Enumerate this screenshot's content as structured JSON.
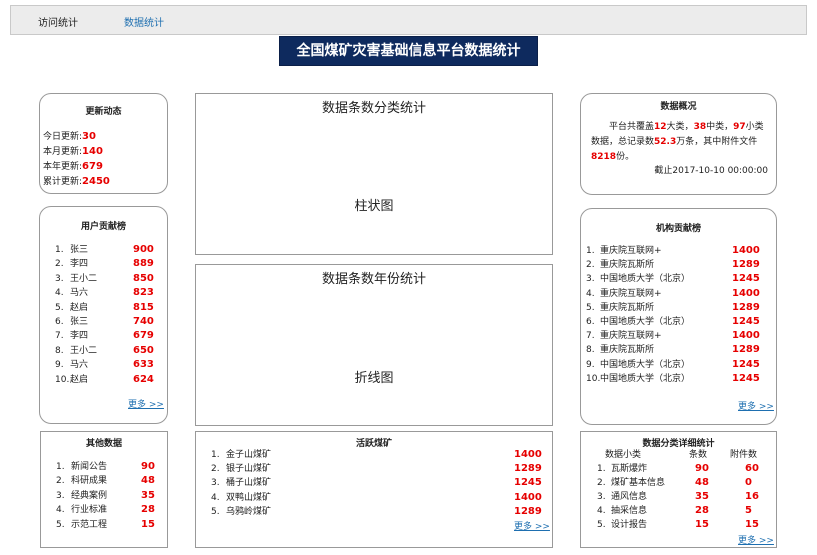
{
  "tabs": [
    {
      "label": "访问统计"
    },
    {
      "label": "数据统计"
    }
  ],
  "title": "全国煤矿灾害基础信息平台数据统计",
  "updates": {
    "title": "更新动态",
    "rows": [
      {
        "label": "今日更新:",
        "value": "30"
      },
      {
        "label": "本月更新:",
        "value": "140"
      },
      {
        "label": "本年更新:",
        "value": "679"
      },
      {
        "label": "累计更新:",
        "value": "2450"
      }
    ]
  },
  "category_chart": {
    "title": "数据条数分类统计",
    "placeholder": "柱状图"
  },
  "year_chart": {
    "title": "数据条数年份统计",
    "placeholder": "折线图"
  },
  "overview": {
    "title": "数据概况",
    "text_parts": [
      "平台共覆盖",
      "12",
      "大类，",
      "38",
      "中类，",
      "97",
      "小类数据，总记录数",
      "52.3",
      "万条，其中附件文件",
      "8218",
      "份。"
    ],
    "date": "截止2017-10-10 00:00:00"
  },
  "user_contrib": {
    "title": "用户贡献榜",
    "items": [
      {
        "num": "1.",
        "name": "张三",
        "value": "900"
      },
      {
        "num": "2.",
        "name": "李四",
        "value": "889"
      },
      {
        "num": "3.",
        "name": "王小二",
        "value": "850"
      },
      {
        "num": "4.",
        "name": "马六",
        "value": "823"
      },
      {
        "num": "5.",
        "name": "赵启",
        "value": "815"
      },
      {
        "num": "6.",
        "name": "张三",
        "value": "740"
      },
      {
        "num": "7.",
        "name": "李四",
        "value": "679"
      },
      {
        "num": "8.",
        "name": "王小二",
        "value": "650"
      },
      {
        "num": "9.",
        "name": "马六",
        "value": "633"
      },
      {
        "num": "10.",
        "name": "赵启",
        "value": "624"
      }
    ],
    "more": "更多 >>"
  },
  "org_contrib": {
    "title": "机构贡献榜",
    "items": [
      {
        "num": "1.",
        "name": "重庆院互联网+",
        "value": "1400"
      },
      {
        "num": "2.",
        "name": "重庆院瓦斯所",
        "value": "1289"
      },
      {
        "num": "3.",
        "name": "中国地质大学（北京）",
        "value": "1245"
      },
      {
        "num": "4.",
        "name": "重庆院互联网+",
        "value": "1400"
      },
      {
        "num": "5.",
        "name": "重庆院瓦斯所",
        "value": "1289"
      },
      {
        "num": "6.",
        "name": "中国地质大学（北京）",
        "value": "1245"
      },
      {
        "num": "7.",
        "name": "重庆院互联网+",
        "value": "1400"
      },
      {
        "num": "8.",
        "name": "重庆院瓦斯所",
        "value": "1289"
      },
      {
        "num": "9.",
        "name": "中国地质大学（北京）",
        "value": "1245"
      },
      {
        "num": "10.",
        "name": "中国地质大学（北京）",
        "value": "1245"
      }
    ],
    "more": "更多 >>"
  },
  "other_data": {
    "title": "其他数据",
    "items": [
      {
        "num": "1.",
        "name": "新闻公告",
        "value": "90"
      },
      {
        "num": "2.",
        "name": "科研成果",
        "value": "48"
      },
      {
        "num": "3.",
        "name": "经典案例",
        "value": "35"
      },
      {
        "num": "4.",
        "name": "行业标准",
        "value": "28"
      },
      {
        "num": "5.",
        "name": "示范工程",
        "value": "15"
      }
    ]
  },
  "active_mines": {
    "title": "活跃煤矿",
    "items": [
      {
        "num": "1.",
        "name": "金子山煤矿",
        "value": "1400"
      },
      {
        "num": "2.",
        "name": "银子山煤矿",
        "value": "1289"
      },
      {
        "num": "3.",
        "name": "桶子山煤矿",
        "value": "1245"
      },
      {
        "num": "4.",
        "name": "双鸭山煤矿",
        "value": "1400"
      },
      {
        "num": "5.",
        "name": "乌鸦岭煤矿",
        "value": "1289"
      }
    ],
    "more": "更多 >>"
  },
  "category_detail": {
    "title": "数据分类详细统计",
    "headers": [
      "数据小类",
      "条数",
      "附件数"
    ],
    "rows": [
      {
        "num": "1.",
        "name": "瓦斯爆炸",
        "count": "90",
        "files": "60"
      },
      {
        "num": "2.",
        "name": "煤矿基本信息",
        "count": "48",
        "files": "0"
      },
      {
        "num": "3.",
        "name": "通风信息",
        "count": "35",
        "files": "16"
      },
      {
        "num": "4.",
        "name": "抽采信息",
        "count": "28",
        "files": "5"
      },
      {
        "num": "5.",
        "name": "设计报告",
        "count": "15",
        "files": "15"
      }
    ],
    "more": "更多 >>"
  }
}
